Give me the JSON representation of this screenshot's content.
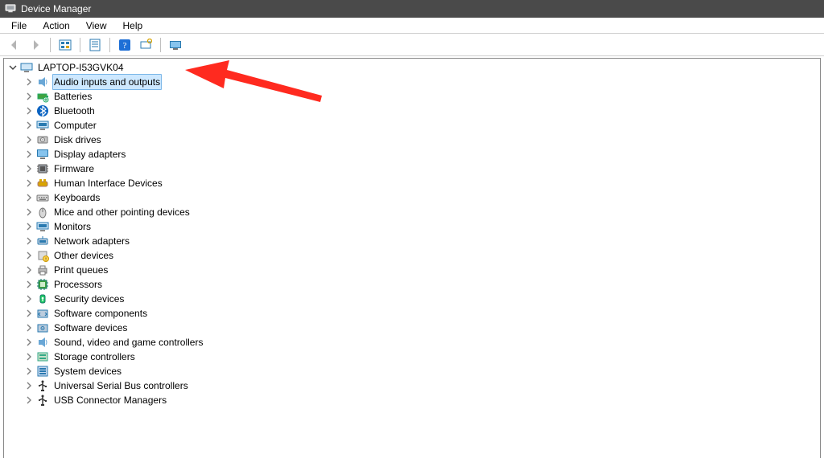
{
  "title": "Device Manager",
  "menu": {
    "file": "File",
    "action": "Action",
    "view": "View",
    "help": "Help"
  },
  "toolbar": {
    "back": "back",
    "forward": "forward",
    "show_hidden": "show-hidden",
    "properties": "properties",
    "help": "help",
    "scan": "scan-hardware",
    "monitor": "monitor"
  },
  "tree": {
    "root": "LAPTOP-I53GVK04",
    "items": [
      {
        "label": "Audio inputs and outputs",
        "icon": "speaker",
        "selected": true
      },
      {
        "label": "Batteries",
        "icon": "battery"
      },
      {
        "label": "Bluetooth",
        "icon": "bluetooth"
      },
      {
        "label": "Computer",
        "icon": "monitor"
      },
      {
        "label": "Disk drives",
        "icon": "disk"
      },
      {
        "label": "Display adapters",
        "icon": "display"
      },
      {
        "label": "Firmware",
        "icon": "chip"
      },
      {
        "label": "Human Interface Devices",
        "icon": "hid"
      },
      {
        "label": "Keyboards",
        "icon": "keyboard"
      },
      {
        "label": "Mice and other pointing devices",
        "icon": "mouse"
      },
      {
        "label": "Monitors",
        "icon": "monitor"
      },
      {
        "label": "Network adapters",
        "icon": "network"
      },
      {
        "label": "Other devices",
        "icon": "other"
      },
      {
        "label": "Print queues",
        "icon": "printer"
      },
      {
        "label": "Processors",
        "icon": "processor"
      },
      {
        "label": "Security devices",
        "icon": "security"
      },
      {
        "label": "Software components",
        "icon": "softcomp"
      },
      {
        "label": "Software devices",
        "icon": "softdev"
      },
      {
        "label": "Sound, video and game controllers",
        "icon": "speaker"
      },
      {
        "label": "Storage controllers",
        "icon": "storage"
      },
      {
        "label": "System devices",
        "icon": "system"
      },
      {
        "label": "Universal Serial Bus controllers",
        "icon": "usb"
      },
      {
        "label": "USB Connector Managers",
        "icon": "usb"
      }
    ]
  },
  "annotation": {
    "arrow_color": "#ff2a1f"
  }
}
